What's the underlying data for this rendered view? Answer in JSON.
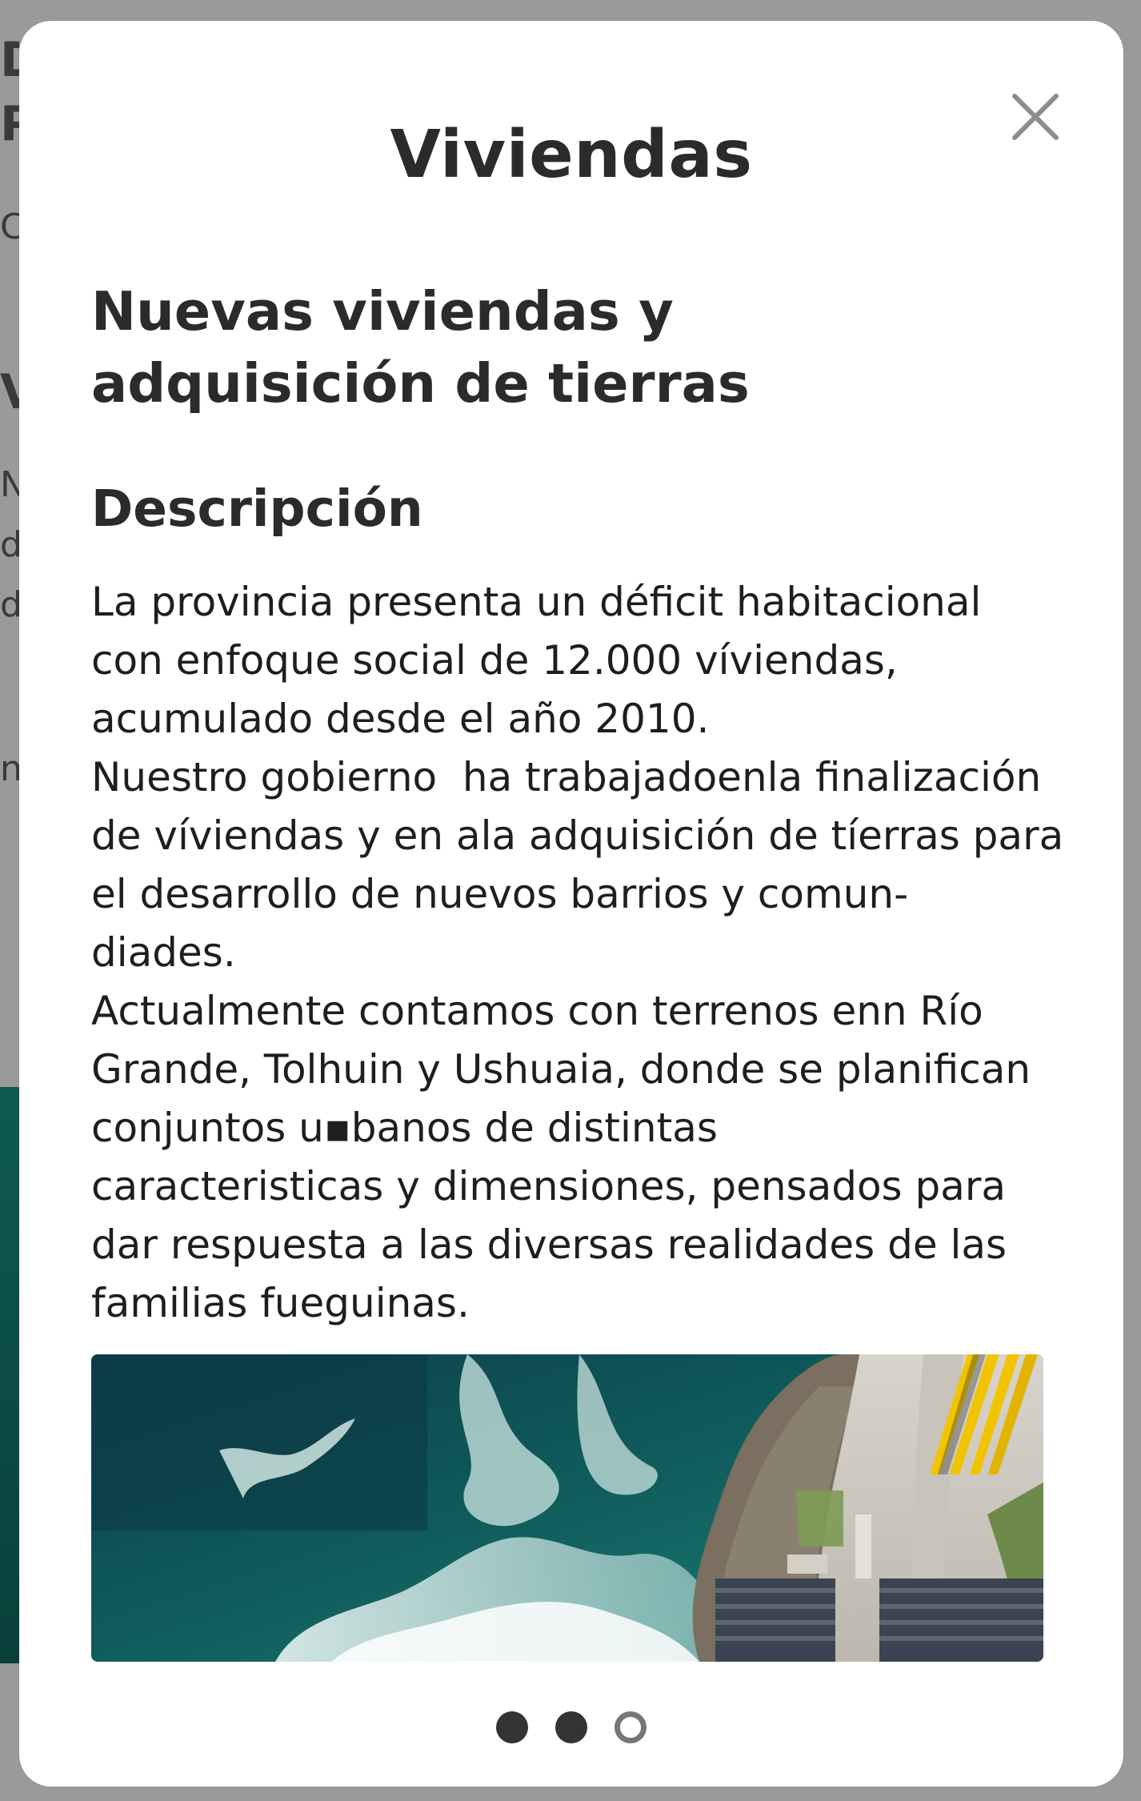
{
  "background": {
    "fragments": [
      "D",
      "P",
      "Ct",
      "V",
      "N",
      "d",
      "d",
      "n"
    ]
  },
  "modal": {
    "title": "Viviendas",
    "close_icon": "close-icon",
    "project_title_line1": "Nuevas viviendas y",
    "project_title_line2": "adquisición de tierras",
    "section_heading": "Descripción",
    "description_paragraphs": [
      "La provincia presenta un déficit habitacional\ncon enfoque social de 12.000 víviendas,\nacumulado desde el año 2010.",
      "Nuestro gobierno  ha trabajadoenla finalización\nde víviendas y en ala adquisición de tíerras para\nel desarrollo de nuevos barrios y comun-\ndiades.",
      "Actualmente contamos con terrenos enn Río\nGrande, Tolhuin y Ushuaia, donde se planifican\nconjuntos u▪banos de distintas\ncaracteristicas y dimensiones, pensados para\ndar respuesta a las diversas realidades de las\nfamilias fueguinas."
    ],
    "carousel": {
      "slide_count": 3,
      "active_index": 2,
      "image_name": "aerial-coastline-photo"
    },
    "colors": {
      "title": "#2b2b2b",
      "text": "#1e1e1e",
      "dot_filled": "#333333",
      "dot_empty_border": "#777777",
      "close_icon": "#8c8c8c"
    }
  }
}
